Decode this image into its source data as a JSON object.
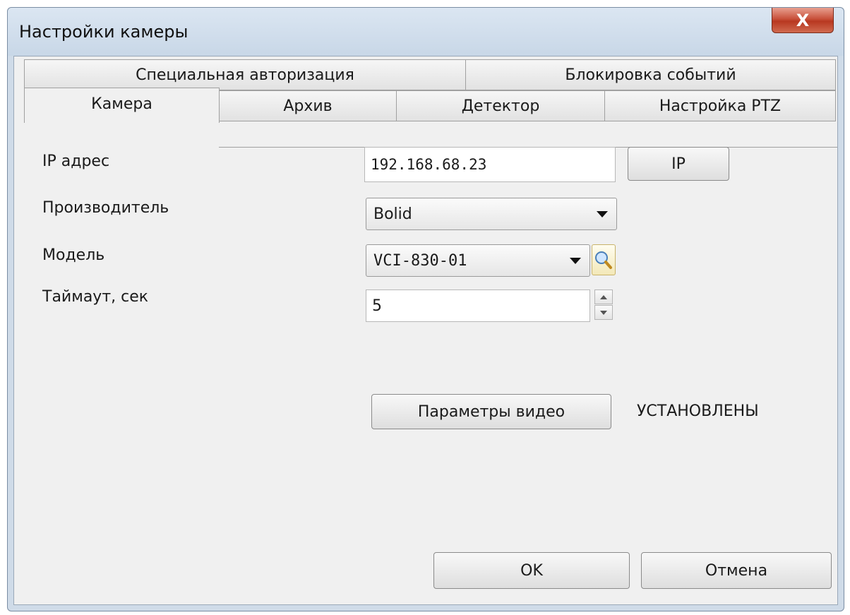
{
  "window": {
    "title": "Настройки камеры",
    "close_glyph": "X"
  },
  "tabs_top": [
    {
      "label": "Специальная авторизация"
    },
    {
      "label": "Блокировка событий"
    }
  ],
  "tabs_bottom": [
    {
      "label": "Камера",
      "active": true
    },
    {
      "label": "Архив"
    },
    {
      "label": "Детектор"
    },
    {
      "label": "Настройка PTZ"
    }
  ],
  "form": {
    "ip_label": "IP адрес",
    "ip_value": "192.168.68.23",
    "ip_button": "IP",
    "vendor_label": "Производитель",
    "vendor_value": "Bolid",
    "model_label": "Модель",
    "model_value": "VCI-830-01",
    "timeout_label": "Таймаут, сек",
    "timeout_value": "5",
    "video_button": "Параметры видео",
    "video_status": "УСТАНОВЛЕНЫ"
  },
  "footer": {
    "ok": "OK",
    "cancel": "Отмена"
  },
  "icons": [
    "close-icon",
    "chevron-down-icon",
    "search-icon",
    "spin-up-icon",
    "spin-down-icon"
  ]
}
